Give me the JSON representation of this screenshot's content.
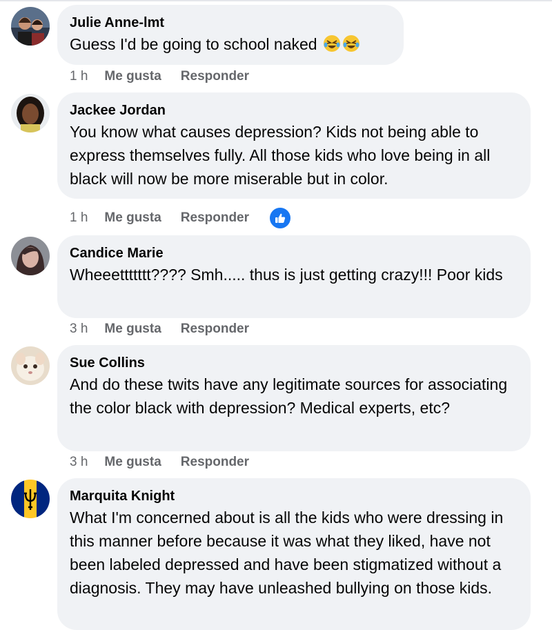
{
  "comments": [
    {
      "name": "Julie Anne-lmt",
      "text": "Guess I'd be going to school naked",
      "time": "1 h",
      "like": "Me gusta",
      "reply": "Responder",
      "emoji": [
        "rolling-on-floor-laughing",
        "rolling-on-floor-laughing"
      ]
    },
    {
      "name": "Jackee Jordan",
      "text": "You know what causes depression? Kids not being able to express themselves fully. All those kids who love being in all black will now be more miserable but in color.",
      "time": "1 h",
      "like": "Me gusta",
      "reply": "Responder",
      "reaction": "like"
    },
    {
      "name": "Candice Marie",
      "text": "Wheeettttttt???? Smh..... thus is just getting crazy!!! Poor kids",
      "time": "3 h",
      "like": "Me gusta",
      "reply": "Responder"
    },
    {
      "name": "Sue Collins",
      "text": "And do these twits have any legitimate sources for associating the color black with depression? Medical experts, etc?",
      "time": "3 h",
      "like": "Me gusta",
      "reply": "Responder"
    },
    {
      "name": "Marquita Knight",
      "text": "What I'm concerned about is all the kids who were dressing in this manner before because it was what they liked, have not been labeled depressed and have been stigmatized without a diagnosis. They may have unleashed bullying on those kids."
    }
  ],
  "colors": {
    "bubble": "#f0f2f5",
    "meta": "#65676b",
    "like_blue": "#1877f2"
  }
}
